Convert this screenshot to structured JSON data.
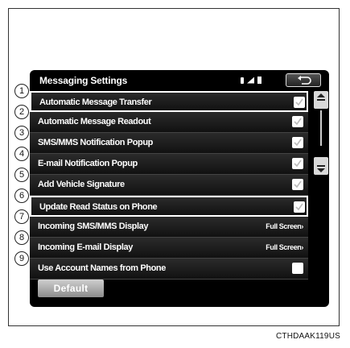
{
  "screen": {
    "title": "Messaging Settings",
    "default_label": "Default"
  },
  "rows": [
    {
      "num": "1",
      "label": "Automatic Message Transfer",
      "control": "checkbox",
      "checked": true,
      "highlight": true
    },
    {
      "num": "2",
      "label": "Automatic Message Readout",
      "control": "checkbox",
      "checked": true
    },
    {
      "num": "3",
      "label": "SMS/MMS Notification Popup",
      "control": "checkbox",
      "checked": true
    },
    {
      "num": "4",
      "label": "E-mail Notification Popup",
      "control": "checkbox",
      "checked": true
    },
    {
      "num": "5",
      "label": "Add Vehicle Signature",
      "control": "checkbox",
      "checked": true
    },
    {
      "num": "6",
      "label": "Update Read Status on Phone",
      "control": "checkbox",
      "checked": true,
      "highlight": true
    },
    {
      "num": "7",
      "label": "Incoming SMS/MMS Display",
      "control": "value",
      "value": "Full Screen›"
    },
    {
      "num": "8",
      "label": "Incoming E-mail Display",
      "control": "value",
      "value": "Full Screen›"
    },
    {
      "num": "9",
      "label": "Use Account Names from Phone",
      "control": "checkbox",
      "checked": false
    }
  ],
  "icons": {
    "status": [
      "bluetooth-icon",
      "signal-icon",
      "battery-icon"
    ],
    "back": "back-arrow-icon",
    "scroll_up": "scroll-up-arrow-icon",
    "scroll_down": "scroll-down-arrow-icon",
    "check": "checkmark-icon"
  },
  "caption": "CTHDAAK119US"
}
